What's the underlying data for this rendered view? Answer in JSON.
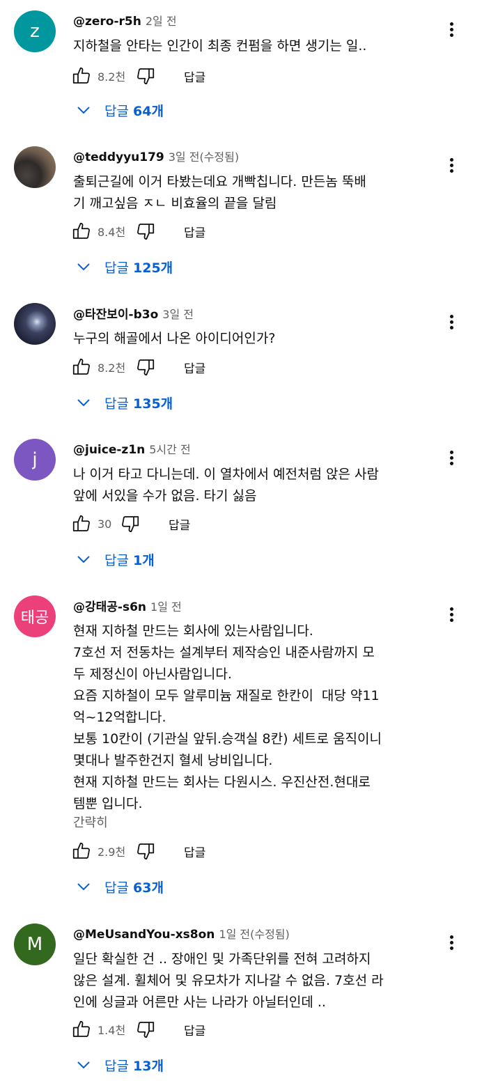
{
  "labels": {
    "reply": "답글",
    "collapse": "간략히",
    "replies_prefix": "답글"
  },
  "comments": [
    {
      "author": "@zero-r5h",
      "time": "2일 전",
      "avatar_letter": "z",
      "avatar_color": "#00979f",
      "text": "지하철을 안타는 인간이 최종 컨펌을 하면 생기는 일..",
      "likes": "8.2천",
      "reply_count": "64개"
    },
    {
      "author": "@teddyyu179",
      "time": "3일 전(수정됨)",
      "avatar_letter": "",
      "text": "출퇴근길에 이거 타봤는데요 개빡칩니다. 만든놈 뚝배\n기 깨고싶음 ㅈㄴ 비효율의 끝을 달림",
      "likes": "8.4천",
      "reply_count": "125개"
    },
    {
      "author": "@타잔보이-b3o",
      "time": "3일 전",
      "avatar_letter": "",
      "text": "누구의 해골에서 나온 아이디어인가?",
      "likes": "8.2천",
      "reply_count": "135개"
    },
    {
      "author": "@juice-z1n",
      "time": "5시간 전",
      "avatar_letter": "j",
      "avatar_color": "#7d57c1",
      "text": "나 이거 타고 다니는데. 이 열차에서 예전처럼 앉은 사람\n앞에 서있을 수가 없음. 타기 싫음",
      "likes": "30",
      "reply_count": "1개"
    },
    {
      "author": "@강태공-s6n",
      "time": "1일 전",
      "avatar_letter": "태공",
      "avatar_color": "#ec407a",
      "text": "현재 지하철 만드는 회사에 있는사람입니다.\n7호선 저 전동차는 설계부터 제작승인 내준사람까지 모\n두 제정신이 아닌사람입니다.\n요즘 지하철이 모두 알루미늄 재질로 한칸이  대당 약11\n억~12억합니다.\n보통 10칸이 (기관실 앞뒤.승객실 8칸) 세트로 움직이니\n몇대나 발주한건지 혈세 낭비입니다.\n현재 지하철 만드는 회사는 다원시스. 우진산전.현대로\n템뿐 입니다.",
      "likes": "2.9천",
      "reply_count": "63개"
    },
    {
      "author": "@MeUsandYou-xs8on",
      "time": "1일 전(수정됨)",
      "avatar_letter": "M",
      "avatar_color": "#33691e",
      "text": "일단 확실한 건 .. 장애인 및 가족단위를 전혀 고려하지\n않은 설계. 휠체어 및 유모차가 지나갈 수 없음. 7호선 라\n인에 싱글과 어른만 사는 나라가 아닐터인데 ..",
      "likes": "1.4천",
      "reply_count": "13개"
    }
  ]
}
